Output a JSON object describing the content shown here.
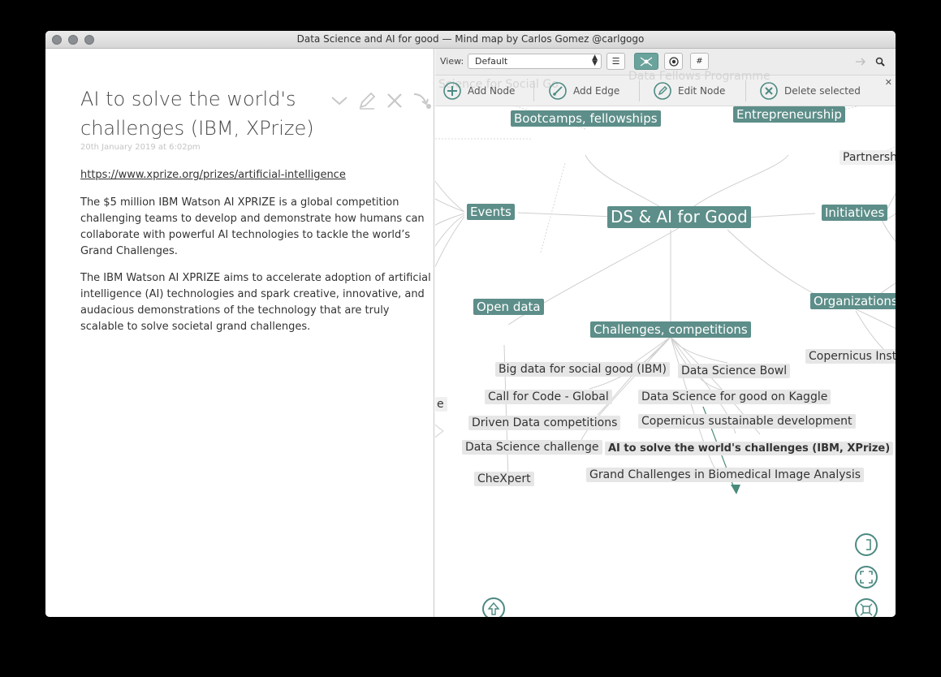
{
  "window": {
    "title": "Data Science and AI for good — Mind map by Carlos Gomez @carlgogo"
  },
  "note": {
    "title": "AI to solve the world's challenges (IBM, XPrize)",
    "date": "20th January 2019 at 6:02pm",
    "link": "https://www.xprize.org/prizes/artificial-intelligence",
    "paragraphs": [
      "The $5 million IBM Watson AI XPRIZE is a global competition challenging teams to develop and demonstrate how humans can collaborate with powerful AI technologies to tackle the world’s Grand Challenges.",
      "The IBM Watson AI XPRIZE aims to accelerate adoption of artificial intelligence (AI) technologies and spark creative, innovative, and audacious demonstrations of the technology that are truly scalable to solve societal grand challenges."
    ]
  },
  "toolbar": {
    "view_label": "View:",
    "view_value": "Default",
    "add_node": "Add Node",
    "add_edge": "Add Edge",
    "edit_node": "Edit Node",
    "delete_selected": "Delete selected"
  },
  "colors": {
    "node_teal": "#5d8e89",
    "node_gray": "#e6e6e6",
    "control_accent": "#4c8a82"
  },
  "graph": {
    "center": "DS & AI for Good",
    "hubs": {
      "bootcamps": "Bootcamps, fellowships",
      "entrepreneurship": "Entrepreneurship",
      "events": "Events",
      "initiatives": "Initiatives",
      "open_data": "Open data",
      "challenges": "Challenges, competitions",
      "organizations": "Organizations",
      "partnerships": "Partnersh"
    },
    "faded_labels": {
      "top_left": "Science for Social Go",
      "top_center": "Data Fellows Programme"
    },
    "leaves": {
      "big_data": "Big data for social good (IBM)",
      "ds_bowl": "Data Science Bowl",
      "call_for_code": "Call for Code - Global",
      "ds_kaggle": "Data Science for good on Kaggle",
      "driven_data": "Driven Data competitions",
      "copernicus_sd": "Copernicus sustainable development",
      "ds_challenge": "Data Science challenge",
      "ai_world": "AI to solve the world's challenges (IBM, XPrize)",
      "chexpert": "CheXpert",
      "grand_challenges": "Grand Challenges in Biomedical Image Analysis",
      "copernicus_inst": "Copernicus Insti",
      "cut_e": "e"
    }
  }
}
